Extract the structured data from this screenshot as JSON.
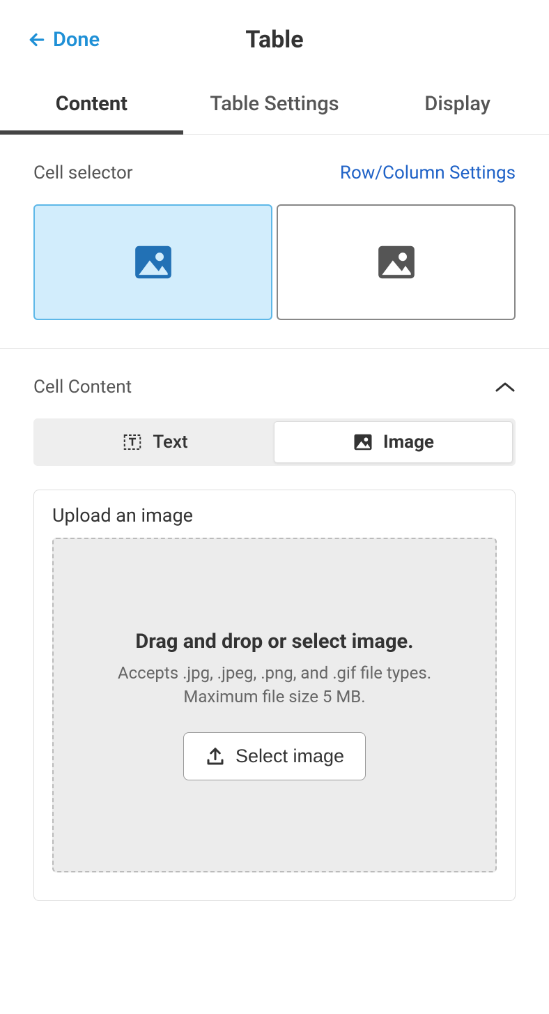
{
  "header": {
    "done_label": "Done",
    "title": "Table"
  },
  "tabs": [
    {
      "label": "Content",
      "active": true
    },
    {
      "label": "Table Settings",
      "active": false
    },
    {
      "label": "Display",
      "active": false
    }
  ],
  "cell_selector": {
    "label": "Cell selector",
    "settings_link": "Row/Column Settings"
  },
  "cell_content": {
    "label": "Cell Content",
    "options": {
      "text": "Text",
      "image": "Image"
    }
  },
  "upload": {
    "title": "Upload an image",
    "primary": "Drag and drop or select image.",
    "accepts": "Accepts .jpg, .jpeg, .png, and .gif file types.",
    "max_size": "Maximum file size 5 MB.",
    "button": "Select image"
  }
}
